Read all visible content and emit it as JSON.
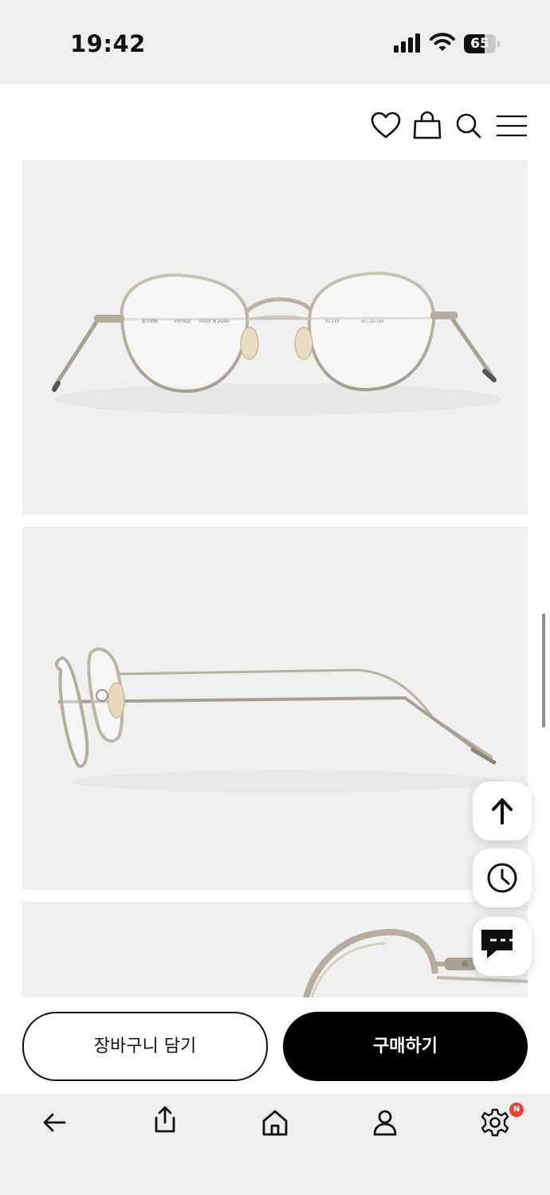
{
  "status_bar": {
    "time": "19:42",
    "battery_level": "65",
    "icons": [
      "cellular-signal-icon",
      "wifi-icon",
      "battery-icon"
    ]
  },
  "header": {
    "icons": [
      "heart-icon",
      "shopping-bag-icon",
      "search-icon",
      "menu-icon"
    ]
  },
  "product_images": [
    {
      "view": "front",
      "engravings": [
        "金子眼鏡",
        "VINTAGE",
        "MADE IN JAPAN",
        "65-143",
        "45□20-140"
      ]
    },
    {
      "view": "side"
    },
    {
      "view": "bridge close-up"
    }
  ],
  "floating_buttons": [
    "scroll-to-top-icon",
    "recently-viewed-clock-icon",
    "chat-icon"
  ],
  "actions": {
    "add_to_cart_label": "장바구니 담기",
    "buy_label": "구매하기"
  },
  "browser_toolbar": {
    "icons": [
      "back-arrow-icon",
      "share-icon",
      "home-icon",
      "account-icon",
      "settings-gear-icon"
    ],
    "settings_badge": "N"
  },
  "colors": {
    "primary_button": "#000000",
    "badge": "#e8413b",
    "photo_background": "#f0f0f0"
  }
}
